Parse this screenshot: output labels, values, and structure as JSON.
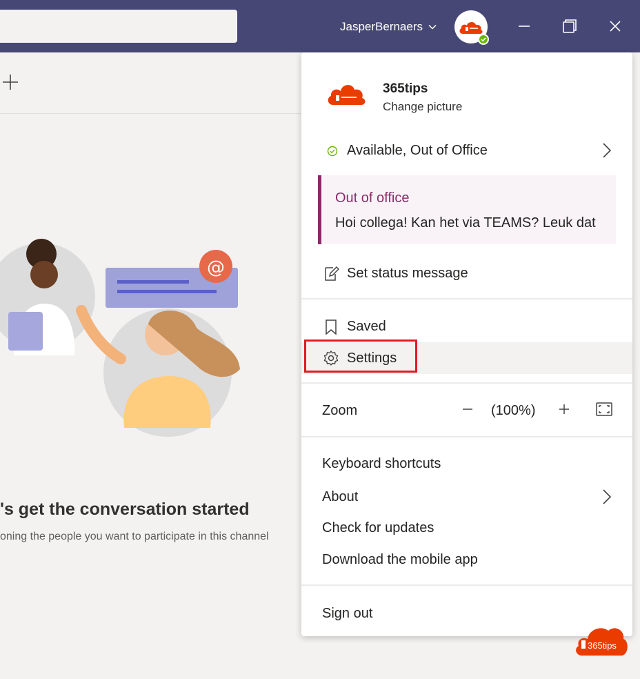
{
  "titlebar": {
    "username": "JasperBernaers"
  },
  "conversation": {
    "title": "'s get the conversation started",
    "subtitle": "oning the people you want to participate in this channel"
  },
  "menu": {
    "profile": {
      "name": "365tips",
      "change_picture": "Change picture"
    },
    "status": "Available, Out of Office",
    "out_of_office": {
      "title": "Out of office",
      "message": "Hoi collega! Kan het via TEAMS? Leuk dat"
    },
    "set_status_message": "Set status message",
    "saved": "Saved",
    "settings": "Settings",
    "zoom": {
      "label": "Zoom",
      "value": "(100%)"
    },
    "keyboard_shortcuts": "Keyboard shortcuts",
    "about": "About",
    "check_updates": "Check for updates",
    "download_app": "Download the mobile app",
    "sign_out": "Sign out"
  },
  "watermark": {
    "text": "365tips"
  },
  "colors": {
    "titlebar": "#464775",
    "accent_purple": "#8b2a6b",
    "office_orange": "#eb3c00",
    "highlight_red": "#e21b23",
    "available_green": "#6bb700"
  }
}
